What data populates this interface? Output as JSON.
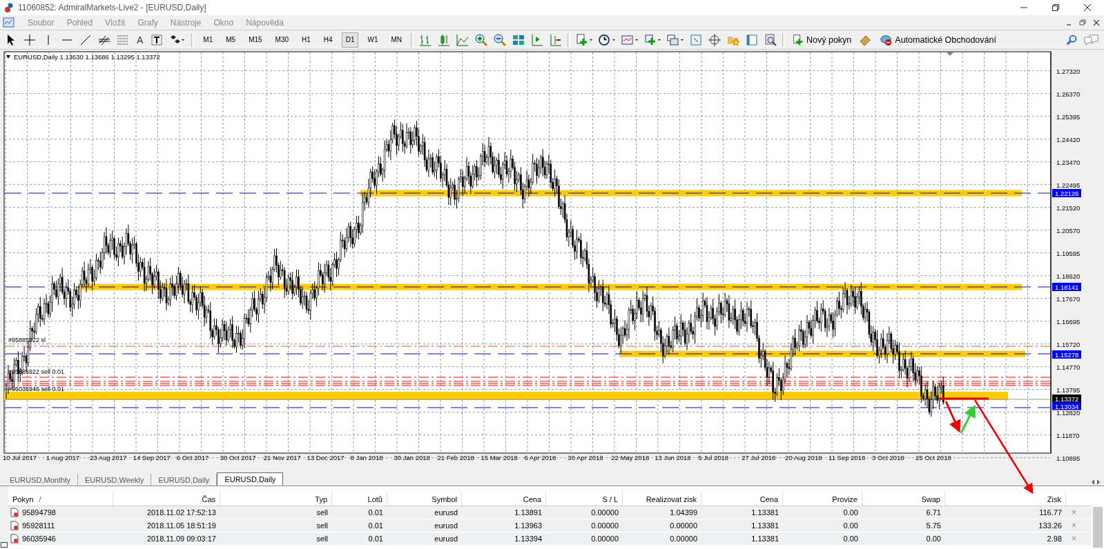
{
  "window": {
    "title": "11060852: AdmiralMarkets-Live2 - [EURUSD,Daily]"
  },
  "menu": [
    "Soubor",
    "Pohled",
    "Vložit",
    "Grafy",
    "Nástroje",
    "Okno",
    "Nápověda"
  ],
  "toolbar": {
    "text_tool": "A",
    "timeframes": [
      {
        "label": "M1",
        "selected": false
      },
      {
        "label": "M5",
        "selected": false
      },
      {
        "label": "M15",
        "selected": false
      },
      {
        "label": "M30",
        "selected": false
      },
      {
        "label": "H1",
        "selected": false
      },
      {
        "label": "H4",
        "selected": false
      },
      {
        "label": "D1",
        "selected": true
      },
      {
        "label": "W1",
        "selected": false
      },
      {
        "label": "MN",
        "selected": false
      }
    ],
    "new_order": "Nový pokyn",
    "auto_trading": "Automatické Obchodování"
  },
  "chart": {
    "header": "EURUSD,Daily  1.13630 1.13686 1.13295 1.13372",
    "y_labels": [
      "1.27320",
      "1.26370",
      "1.25395",
      "1.24420",
      "1.23470",
      "1.22495",
      "1.21520",
      "1.20570",
      "1.19595",
      "1.18620",
      "1.17670",
      "1.16695",
      "1.15720",
      "1.14770",
      "1.13795",
      "1.12820",
      "1.11870",
      "1.10895"
    ],
    "x_labels": [
      "10 Jul 2017",
      "1 Aug 2017",
      "23 Aug 2017",
      "14 Sep 2017",
      "6 Oct 2017",
      "30 Oct 2017",
      "21 Nov 2017",
      "13 Dec 2017",
      "8 Jan 2018",
      "30 Jan 2018",
      "21 Feb 2018",
      "15 Mar 2018",
      "6 Apr 2018",
      "30 Apr 2018",
      "22 May 2018",
      "13 Jun 2018",
      "5 Jul 2018",
      "27 Jul 2018",
      "20 Aug 2018",
      "11 Sep 2018",
      "3 Oct 2018",
      "25 Oct 2018"
    ],
    "price_tags": [
      {
        "text": "1.22126",
        "color": "#0000ff"
      },
      {
        "text": "1.18141",
        "color": "#0000ff"
      },
      {
        "text": "1.15278",
        "color": "#0000ff"
      },
      {
        "text": "1.13372",
        "color": "#000000"
      },
      {
        "text": "1.13034",
        "color": "#0000ff"
      }
    ],
    "order_labels": [
      "#95885922 sl",
      "#95885922 sell 0.01",
      "#96035946 sell 0.01"
    ]
  },
  "chart_tabs": [
    {
      "label": "EURUSD,Monthly",
      "selected": false
    },
    {
      "label": "EURUSD,Weekly",
      "selected": false
    },
    {
      "label": "EURUSD,Daily",
      "selected": false
    },
    {
      "label": "EURUSD,Daily",
      "selected": true
    }
  ],
  "table": {
    "columns": [
      "Pokyn",
      "Čas",
      "Typ",
      "Lotů",
      "Symbol",
      "Cena",
      "S / L",
      "Realizovat zisk",
      "Cena",
      "Provize",
      "Swap",
      "Zisk"
    ],
    "sort_indicator": "/",
    "rows": [
      {
        "cells": [
          "95894798",
          "2018.11.02 17:52:13",
          "sell",
          "0.01",
          "eurusd",
          "1.13891",
          "0.00000",
          "1.04399",
          "1.13381",
          "0.00",
          "6.71",
          "116.77"
        ],
        "close": "×"
      },
      {
        "cells": [
          "95928111",
          "2018.11.05 18:51:19",
          "sell",
          "0.01",
          "eurusd",
          "1.13963",
          "0.00000",
          "0.00000",
          "1.13381",
          "0.00",
          "5.75",
          "133.26"
        ],
        "close": "×"
      },
      {
        "cells": [
          "96035946",
          "2018.11.09 09:03:17",
          "sell",
          "0.01",
          "eurusd",
          "1.13394",
          "0.00000",
          "0.00000",
          "1.13381",
          "0.00",
          "0.00",
          "2.98"
        ],
        "close": "×"
      }
    ]
  }
}
